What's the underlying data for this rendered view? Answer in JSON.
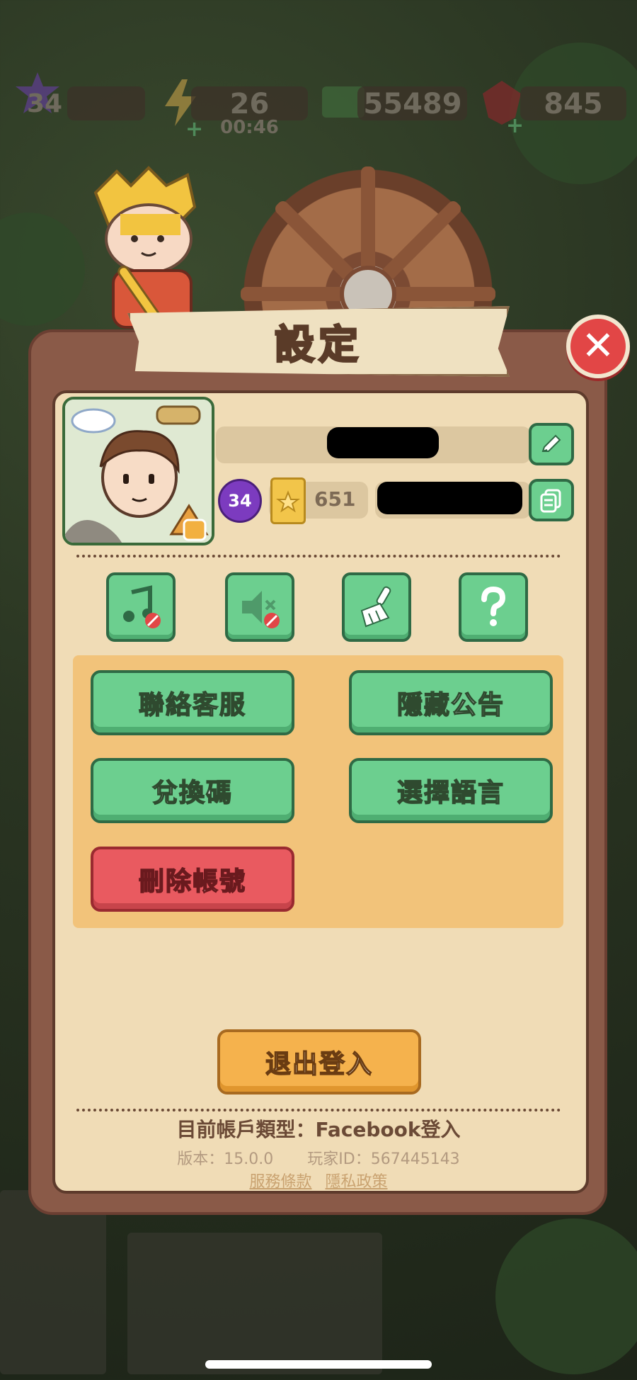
{
  "hud": {
    "level": "34",
    "energy": "26",
    "energy_timer": "00:46",
    "cash": "55489",
    "gems": "845"
  },
  "dialog": {
    "title": "設定",
    "close_icon": "close-icon"
  },
  "profile": {
    "level": "34",
    "points": "651"
  },
  "icon_buttons": [
    {
      "name": "music-toggle-button",
      "icon": "music-muted-icon"
    },
    {
      "name": "sound-toggle-button",
      "icon": "speaker-muted-icon"
    },
    {
      "name": "clean-cache-button",
      "icon": "broom-icon"
    },
    {
      "name": "help-button",
      "icon": "question-icon"
    }
  ],
  "buttons": {
    "contact_support": "聯絡客服",
    "hide_announcement": "隱藏公告",
    "redeem_code": "兌換碼",
    "select_language": "選擇語言",
    "delete_account": "刪除帳號",
    "logout": "退出登入"
  },
  "footer": {
    "account_type": "目前帳戶類型：Facebook登入",
    "version": "版本：15.0.0",
    "player_id": "玩家ID：567445143",
    "terms": "服務條款",
    "privacy": "隱私政策"
  },
  "colors": {
    "panel_bg": "#f0dcb6",
    "panel_border": "#8a5a48",
    "green_button": "#6ccf8f",
    "red_button": "#e95a60",
    "orange_button": "#f5b24d",
    "orange_area": "#f2c37a"
  }
}
